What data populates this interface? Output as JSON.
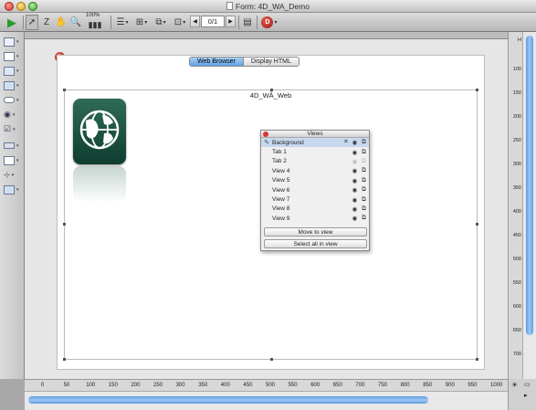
{
  "window": {
    "title": "Form: 4D_WA_Demo"
  },
  "toolbar": {
    "zoom_label": "100%",
    "page_indicator": "0/1",
    "tools": [
      "run-icon",
      "arrow-icon",
      "entry-order-icon",
      "hand-icon",
      "zoom-icon",
      "resize-icon",
      "align-icon",
      "distribute-icon",
      "level-icon",
      "group-icon",
      "page-prev-icon",
      "page-next-icon",
      "views-list-icon",
      "component-icon"
    ],
    "badge": "D"
  },
  "form": {
    "tabs": [
      {
        "label": "Web Browser",
        "active": true
      },
      {
        "label": "Display HTML",
        "active": false
      }
    ],
    "web_area_name": "4D_WÂ_Web",
    "badge": "D"
  },
  "views_panel": {
    "title": "Views",
    "items": [
      {
        "name": "Background",
        "visible": true,
        "locked": true,
        "selected": true,
        "editable": true
      },
      {
        "name": "Tab 1",
        "visible": true,
        "locked": true,
        "selected": false,
        "editable": false
      },
      {
        "name": "Tab 2",
        "visible": false,
        "locked": false,
        "selected": false,
        "editable": false
      },
      {
        "name": "View 4",
        "visible": true,
        "locked": true,
        "selected": false,
        "editable": false
      },
      {
        "name": "View 5",
        "visible": true,
        "locked": true,
        "selected": false,
        "editable": false
      },
      {
        "name": "View 6",
        "visible": true,
        "locked": true,
        "selected": false,
        "editable": false
      },
      {
        "name": "View 7",
        "visible": true,
        "locked": true,
        "selected": false,
        "editable": false
      },
      {
        "name": "View 8",
        "visible": true,
        "locked": true,
        "selected": false,
        "editable": false
      },
      {
        "name": "View 9",
        "visible": true,
        "locked": true,
        "selected": false,
        "editable": false
      }
    ],
    "move_button": "Move to view",
    "select_button": "Select all in view"
  },
  "rulers": {
    "horizontal": [
      "0",
      "50",
      "100",
      "150",
      "200",
      "250",
      "300",
      "350",
      "400",
      "450",
      "500",
      "550",
      "600",
      "650",
      "700",
      "750",
      "800",
      "850",
      "900",
      "950",
      "1000"
    ],
    "vertical": [
      "H",
      "100",
      "150",
      "200",
      "250",
      "300",
      "350",
      "400",
      "450",
      "500",
      "550",
      "600",
      "650",
      "700"
    ]
  },
  "colors": {
    "accent": "#5fa3e6",
    "globe": "#1d5544"
  }
}
